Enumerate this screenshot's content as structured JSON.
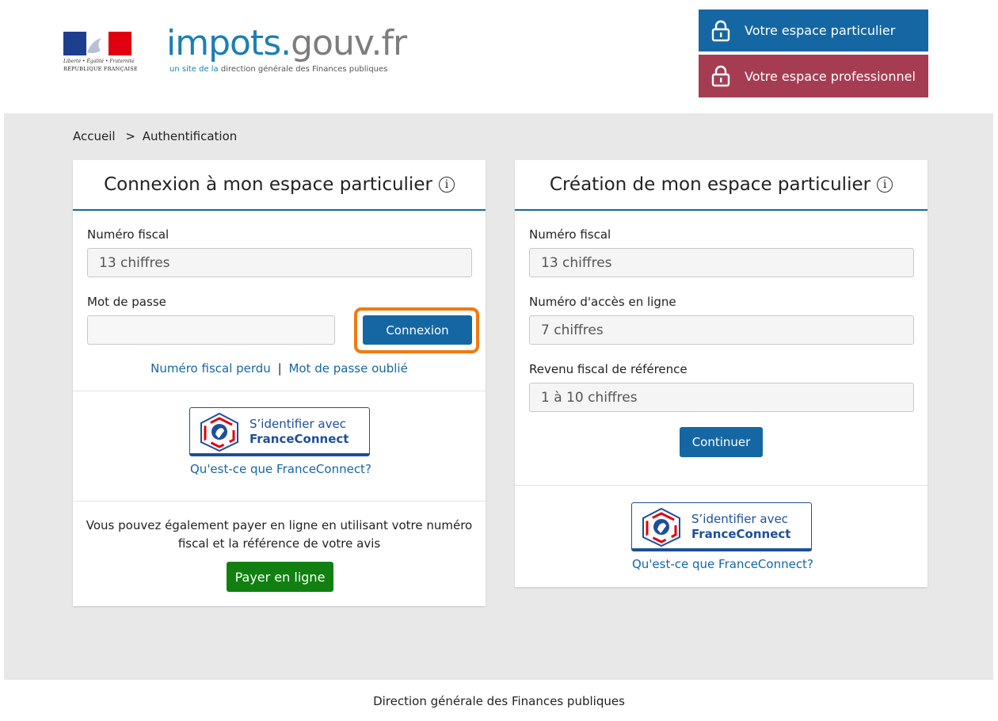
{
  "header": {
    "republic_motto": "Liberté • Égalité • Fraternité",
    "republic_name": "RÉPUBLIQUE FRANÇAISE",
    "site_name_part1": "impots.",
    "site_name_part2": "gouv.fr",
    "tagline_prefix": "un site de la",
    "tagline_rest": " direction générale des Finances publiques",
    "btn_particulier": "Votre espace particulier",
    "btn_professionnel": "Votre espace professionnel"
  },
  "breadcrumb": {
    "home": "Accueil",
    "separator": ">",
    "current": "Authentification"
  },
  "login": {
    "title": "Connexion à mon espace particulier",
    "fiscal_label": "Numéro fiscal",
    "fiscal_placeholder": "13 chiffres",
    "password_label": "Mot de passe",
    "password_placeholder": "",
    "submit": "Connexion",
    "lost_fiscal": "Numéro fiscal perdu",
    "link_sep": "|",
    "forgot_password": "Mot de passe oublié",
    "fc_line1": "S’identifier avec",
    "fc_line2": "FranceConnect",
    "fc_help": "Qu'est-ce que FranceConnect?",
    "pay_text": "Vous pouvez également payer en ligne en utilisant votre numéro fiscal et la référence de votre avis",
    "pay_button": "Payer en ligne"
  },
  "create": {
    "title": "Création de mon espace particulier",
    "fiscal_label": "Numéro fiscal",
    "fiscal_placeholder": "13 chiffres",
    "access_label": "Numéro d'accès en ligne",
    "access_placeholder": "7 chiffres",
    "income_label": "Revenu fiscal de référence",
    "income_placeholder": "1 à 10 chiffres",
    "continue": "Continuer",
    "fc_line1": "S’identifier avec",
    "fc_line2": "FranceConnect",
    "fc_help": "Qu'est-ce que FranceConnect?"
  },
  "footer": {
    "text": "Direction générale des Finances publiques"
  },
  "colors": {
    "primary_blue": "#1567a4",
    "pro_red": "#a63c52",
    "pay_green": "#118011",
    "focus_orange": "#f27a10",
    "background_gray": "#e8e8e8"
  },
  "icons": {
    "lock": "lock-icon",
    "info": "info-icon",
    "franceconnect": "franceconnect-logo"
  }
}
